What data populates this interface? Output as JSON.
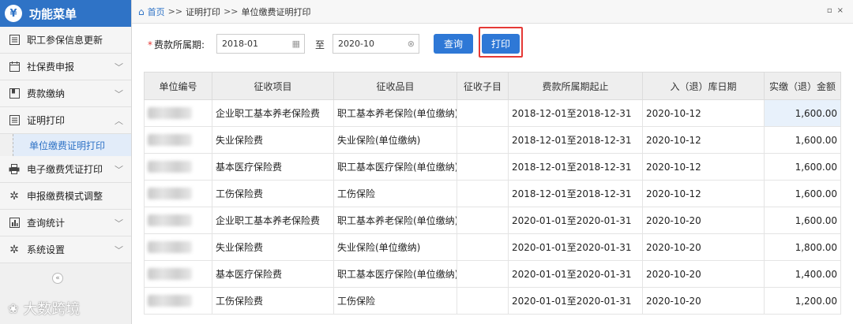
{
  "sidebar": {
    "title": "功能菜单",
    "logo_glyph": "¥",
    "items": [
      {
        "label": "职工参保信息更新",
        "icon": "list-icon",
        "chevron": ""
      },
      {
        "label": "社保费申报",
        "icon": "calendar-icon",
        "chevron": "﹀"
      },
      {
        "label": "费款缴纳",
        "icon": "bookmark-icon",
        "chevron": "﹀"
      },
      {
        "label": "证明打印",
        "icon": "list-icon",
        "chevron": "︿"
      },
      {
        "label": "电子缴费凭证打印",
        "icon": "printer-icon",
        "chevron": "﹀"
      },
      {
        "label": "申报缴费模式调整",
        "icon": "gear-icon",
        "chevron": ""
      },
      {
        "label": "查询统计",
        "icon": "chart-icon",
        "chevron": "﹀"
      },
      {
        "label": "系统设置",
        "icon": "gear-icon",
        "chevron": "﹀"
      }
    ],
    "active_subitem": "单位缴费证明打印",
    "collapse_glyph": "«",
    "watermark": "大数跨境"
  },
  "breadcrumb": {
    "home": "首页",
    "sep": ">>",
    "level1": "证明打印",
    "level2": "单位缴费证明打印",
    "window_buttons": "▫×"
  },
  "filter": {
    "label": "费款所属期:",
    "required_mark": "*",
    "start_value": "2018-01",
    "to_label": "至",
    "end_value": "2020-10",
    "query_button": "查询",
    "print_button": "打印"
  },
  "table": {
    "columns": [
      "单位编号",
      "征收项目",
      "征收品目",
      "征收子目",
      "费款所属期起止",
      "入（退）库日期",
      "实缴（退）金额"
    ],
    "rows": [
      {
        "item": "企业职工基本养老保险费",
        "category": "职工基本养老保险(单位缴纳)",
        "sub": "",
        "period": "2018-12-01至2018-12-31",
        "date": "2020-10-12",
        "amount": "1,600.00"
      },
      {
        "item": "失业保险费",
        "category": "失业保险(单位缴纳)",
        "sub": "",
        "period": "2018-12-01至2018-12-31",
        "date": "2020-10-12",
        "amount": "1,600.00"
      },
      {
        "item": "基本医疗保险费",
        "category": "职工基本医疗保险(单位缴纳)",
        "sub": "",
        "period": "2018-12-01至2018-12-31",
        "date": "2020-10-12",
        "amount": "1,600.00"
      },
      {
        "item": "工伤保险费",
        "category": "工伤保险",
        "sub": "",
        "period": "2018-12-01至2018-12-31",
        "date": "2020-10-12",
        "amount": "1,600.00"
      },
      {
        "item": "企业职工基本养老保险费",
        "category": "职工基本养老保险(单位缴纳)",
        "sub": "",
        "period": "2020-01-01至2020-01-31",
        "date": "2020-10-20",
        "amount": "1,600.00"
      },
      {
        "item": "失业保险费",
        "category": "失业保险(单位缴纳)",
        "sub": "",
        "period": "2020-01-01至2020-01-31",
        "date": "2020-10-20",
        "amount": "1,800.00"
      },
      {
        "item": "基本医疗保险费",
        "category": "职工基本医疗保险(单位缴纳)",
        "sub": "",
        "period": "2020-01-01至2020-01-31",
        "date": "2020-10-20",
        "amount": "1,400.00"
      },
      {
        "item": "工伤保险费",
        "category": "工伤保险",
        "sub": "",
        "period": "2020-01-01至2020-01-31",
        "date": "2020-10-20",
        "amount": "1,200.00"
      }
    ]
  }
}
